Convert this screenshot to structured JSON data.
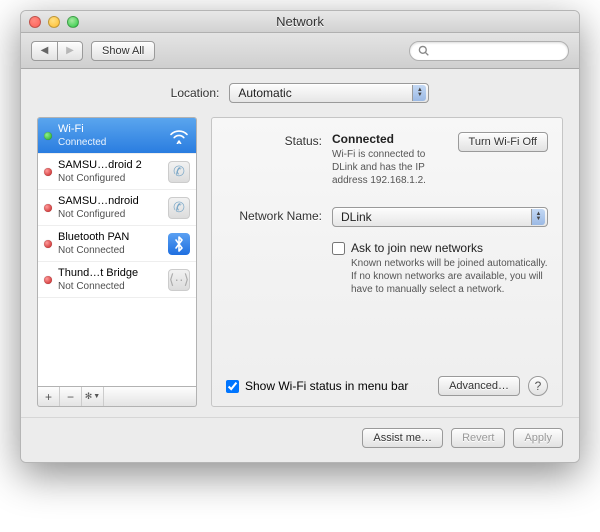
{
  "window": {
    "title": "Network"
  },
  "toolbar": {
    "show_all": "Show All",
    "search_placeholder": ""
  },
  "location": {
    "label": "Location:",
    "value": "Automatic"
  },
  "sidebar": {
    "items": [
      {
        "name": "Wi-Fi",
        "status": "Connected",
        "dot": "green",
        "icon": "wifi",
        "selected": true
      },
      {
        "name": "SAMSU…droid 2",
        "status": "Not Configured",
        "dot": "red",
        "icon": "phone",
        "selected": false
      },
      {
        "name": "SAMSU…ndroid",
        "status": "Not Configured",
        "dot": "red",
        "icon": "phone",
        "selected": false
      },
      {
        "name": "Bluetooth PAN",
        "status": "Not Connected",
        "dot": "red",
        "icon": "bt",
        "selected": false
      },
      {
        "name": "Thund…t Bridge",
        "status": "Not Connected",
        "dot": "red",
        "icon": "tb",
        "selected": false
      }
    ],
    "add": "+",
    "remove": "−",
    "action": "✻▾"
  },
  "detail": {
    "status_label": "Status:",
    "status_value": "Connected",
    "toggle_button": "Turn Wi-Fi Off",
    "status_desc": "Wi-Fi is connected to DLink and has the IP address 192.168.1.2.",
    "network_label": "Network Name:",
    "network_value": "DLink",
    "ask_join": "Ask to join new networks",
    "ask_join_desc": "Known networks will be joined automatically. If no known networks are available, you will have to manually select a network.",
    "show_status": "Show Wi-Fi status in menu bar",
    "advanced": "Advanced…"
  },
  "footer": {
    "assist": "Assist me…",
    "revert": "Revert",
    "apply": "Apply"
  }
}
